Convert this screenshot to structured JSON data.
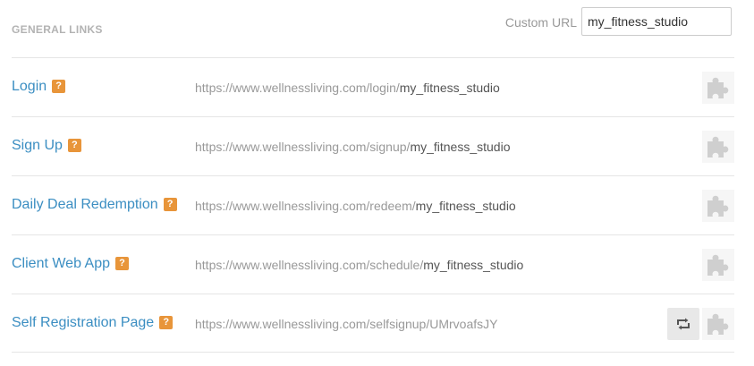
{
  "header": {
    "section_title": "GENERAL LINKS",
    "custom_url_label": "Custom URL",
    "custom_url_value": "my_fitness_studio"
  },
  "help_badge_text": "?",
  "rows": [
    {
      "name": "Login",
      "url_base": "https://www.wellnessliving.com/login/",
      "url_slug": "my_fitness_studio"
    },
    {
      "name": "Sign Up",
      "url_base": "https://www.wellnessliving.com/signup/",
      "url_slug": "my_fitness_studio"
    },
    {
      "name": "Daily Deal Redemption",
      "url_base": "https://www.wellnessliving.com/redeem/",
      "url_slug": "my_fitness_studio"
    },
    {
      "name": "Client Web App",
      "url_base": "https://www.wellnessliving.com/schedule/",
      "url_slug": "my_fitness_studio"
    },
    {
      "name": "Self Registration Page",
      "url_base": "https://www.wellnessliving.com/selfsignup/UMrvoafsJY",
      "url_slug": ""
    }
  ],
  "colors": {
    "link": "#3b8ec2",
    "help_badge": "#e8953a",
    "icon_gray": "#cfcfcf"
  },
  "icons": {
    "puzzle": "puzzle-icon",
    "refresh": "refresh-icon"
  }
}
